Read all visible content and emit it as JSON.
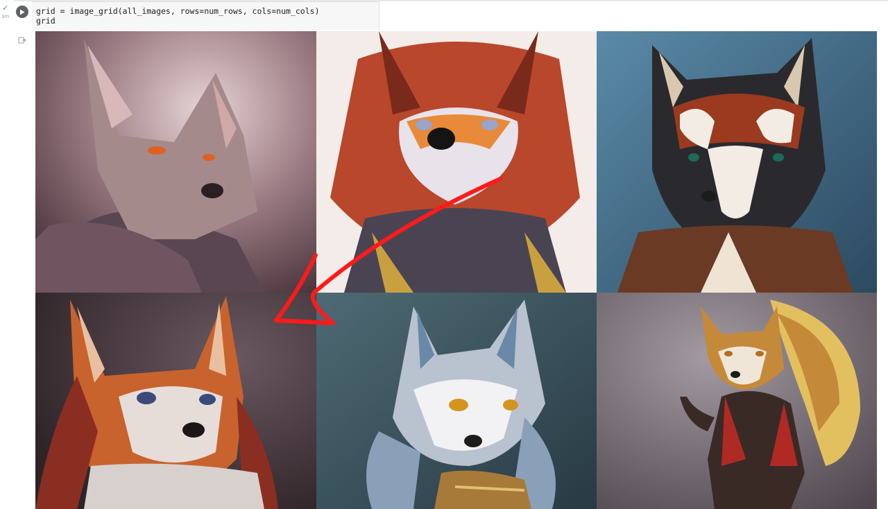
{
  "cell": {
    "status_time": "3m",
    "code_lines": [
      "grid = image_grid(all_images, rows=num_rows, cols=num_cols)",
      "grid"
    ]
  },
  "output_grid": {
    "rows": 2,
    "cols": 3,
    "images": [
      {
        "subject": "mauve fox portrait with glowing orange eyes",
        "bg": "#8c6b72",
        "fur": "#a58a8c",
        "eye": "#e06020"
      },
      {
        "subject": "red fox portrait with white muzzle and armor",
        "bg": "#f4ece8",
        "fur": "#b9472b",
        "eye": "#9aa3c8"
      },
      {
        "subject": "red panda-like fox with black and white mask",
        "bg": "#3f6a88",
        "fur": "#9b3a1e",
        "eye": "#1c6a5a"
      },
      {
        "subject": "ginger fox woman with long red hair",
        "bg": "#4f3d44",
        "fur": "#c8632e",
        "eye": "#3a4a7a"
      },
      {
        "subject": "silver fox with golden eyes and ornate armor",
        "bg": "#3e5963",
        "fur": "#b9c2cf",
        "eye": "#d49520"
      },
      {
        "subject": "fox warrior with large fluffy tail",
        "bg": "#7a6f78",
        "fur": "#c48a3a",
        "eye": "#b07020"
      }
    ]
  },
  "annotation": {
    "arrow_color": "#ff1a1a"
  }
}
